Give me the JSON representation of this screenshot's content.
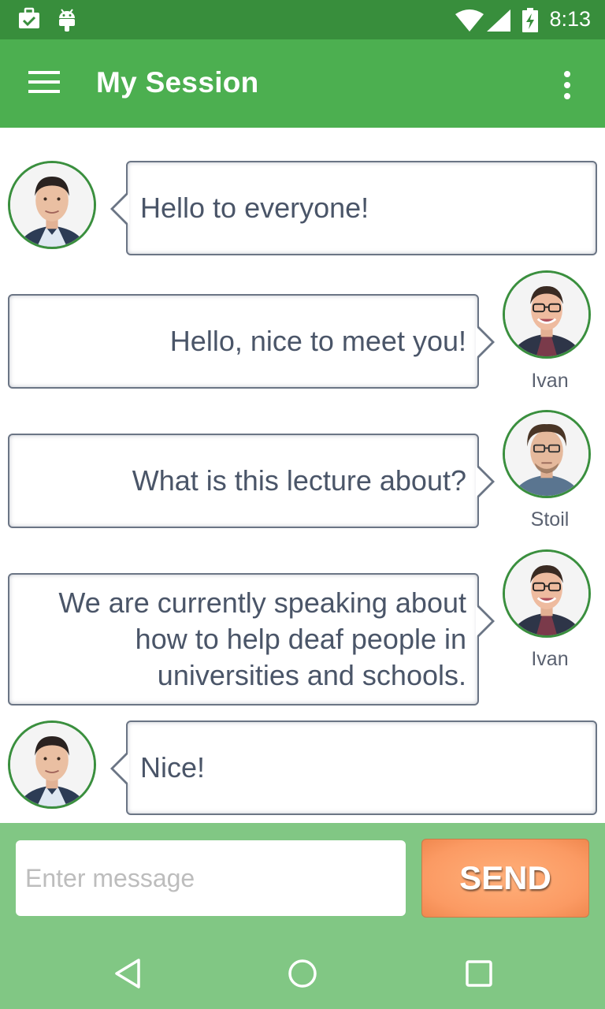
{
  "status_bar": {
    "time": "8:13",
    "icons": [
      "briefcase-check-icon",
      "android-icon",
      "wifi-icon",
      "signal-icon",
      "battery-charging-icon"
    ]
  },
  "app_bar": {
    "title": "My Session",
    "menu_icon": "hamburger-menu-icon",
    "overflow_icon": "more-vert-icon"
  },
  "messages": [
    {
      "side": "left",
      "text": "Hello to everyone!",
      "sender": "",
      "avatar": "avatar-self"
    },
    {
      "side": "right",
      "text": "Hello, nice to meet you!",
      "sender": "Ivan",
      "avatar": "avatar-ivan"
    },
    {
      "side": "right",
      "text": "What is this lecture about?",
      "sender": "Stoil",
      "avatar": "avatar-stoil"
    },
    {
      "side": "right",
      "text": "We are currently speaking about how to help deaf people in universities and schools.",
      "sender": "Ivan",
      "avatar": "avatar-ivan"
    },
    {
      "side": "left",
      "text": "Nice!",
      "sender": "",
      "avatar": "avatar-self"
    }
  ],
  "composer": {
    "placeholder": "Enter message",
    "value": "",
    "send_label": "SEND"
  },
  "nav_bar": {
    "icons": [
      "back-icon",
      "home-icon",
      "recents-icon"
    ]
  },
  "colors": {
    "status_bar": "#388e3c",
    "app_bar": "#4caf50",
    "composer_bg": "#81c784",
    "avatar_ring": "#3a8f3e",
    "bubble_border": "#6b7585",
    "bubble_text": "#4a5568",
    "send_button": "#fb9a63"
  }
}
